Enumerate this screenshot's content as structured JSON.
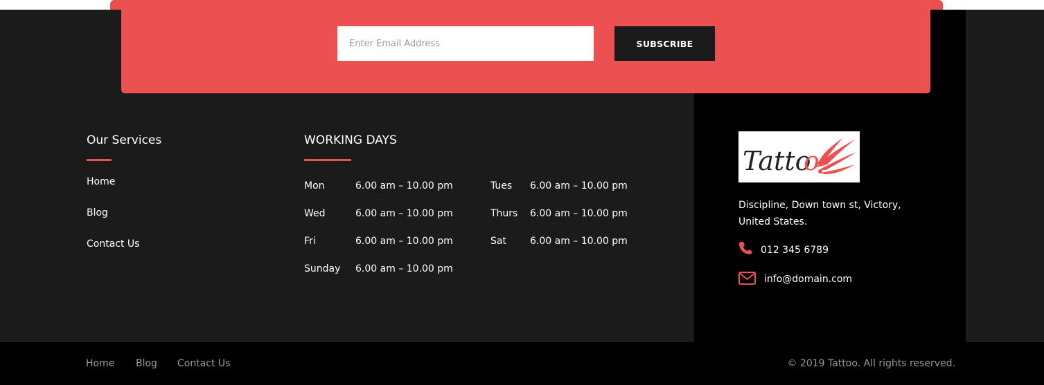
{
  "subscribe": {
    "email_placeholder": "Enter Email Address",
    "button_label": "SUBSCRIBE"
  },
  "services": {
    "heading": "Our Services",
    "links": [
      "Home",
      "Blog",
      "Contact Us"
    ]
  },
  "working_days": {
    "heading": "WORKING DAYS",
    "schedule": [
      {
        "day": "Mon",
        "hours": "6.00 am – 10.00 pm"
      },
      {
        "day": "Tues",
        "hours": "6.00 am – 10.00 pm"
      },
      {
        "day": "Wed",
        "hours": "6.00 am – 10.00 pm"
      },
      {
        "day": "Thurs",
        "hours": "6.00 am – 10.00 pm"
      },
      {
        "day": "Fri",
        "hours": "6.00 am – 10.00 pm"
      },
      {
        "day": "Sat",
        "hours": "6.00 am – 10.00 pm"
      },
      {
        "day": "Sunday",
        "hours": "6.00 am – 10.00 pm"
      }
    ]
  },
  "contact": {
    "logo_text": "Tattoo",
    "address": "Discipline, Down town st, Victory, United States.",
    "phone": "012 345 6789",
    "email": "info@domain.com",
    "phone_icon": "phone-icon",
    "email_icon": "envelope-icon"
  },
  "footer": {
    "links": [
      "Home",
      "Blog",
      "Contact Us"
    ],
    "copyright": "© 2019 Tattoo. All rights reserved."
  },
  "colors": {
    "accent": "#ec5050",
    "dark": "#1b1b1b",
    "black": "#000000"
  }
}
